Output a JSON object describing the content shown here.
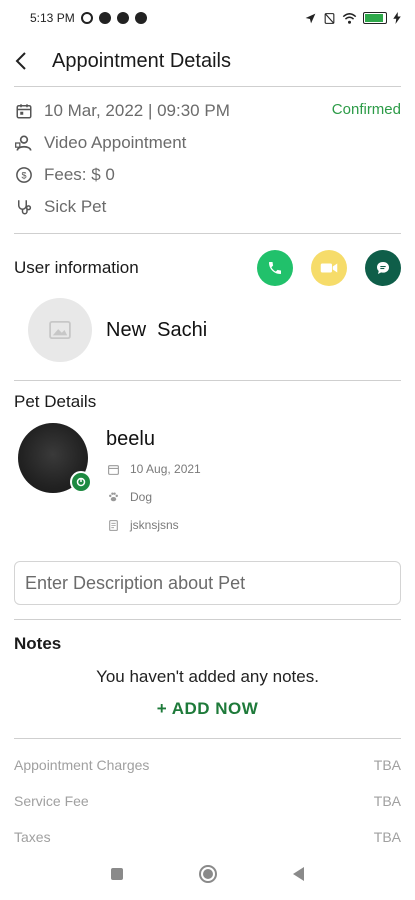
{
  "status_bar": {
    "time": "5:13 PM",
    "battery_level": 0.9
  },
  "header": {
    "title": "Appointment Details",
    "back_icon": "chevron-left-icon"
  },
  "appointment": {
    "datetime": "10 Mar, 2022 | 09:30 PM",
    "type": "Video Appointment",
    "fees": "Fees: $ 0",
    "reason": "Sick Pet",
    "status": "Confirmed"
  },
  "user_info": {
    "title": "User information",
    "name": "New  Sachi",
    "actions": [
      {
        "icon": "phone-icon",
        "color": "#21c16b"
      },
      {
        "icon": "video-icon",
        "color": "#f6dc6a"
      },
      {
        "icon": "chat-icon",
        "color": "#0f5e49"
      }
    ]
  },
  "pet_details": {
    "title": "Pet Details",
    "name": "beelu",
    "birthdate": "10 Aug, 2021",
    "species": "Dog",
    "breed": "jsknsjsns",
    "description_placeholder": "Enter Description about Pet"
  },
  "notes": {
    "title": "Notes",
    "empty_message": "You haven't added any notes.",
    "add_label": "+ ADD NOW"
  },
  "charges": [
    {
      "label": "Appointment Charges",
      "value": "TBA"
    },
    {
      "label": "Service Fee",
      "value": "TBA"
    },
    {
      "label": "Taxes",
      "value": "TBA"
    }
  ],
  "colors": {
    "accent_green": "#2c9b47",
    "add_now": "#1e7a3a"
  }
}
